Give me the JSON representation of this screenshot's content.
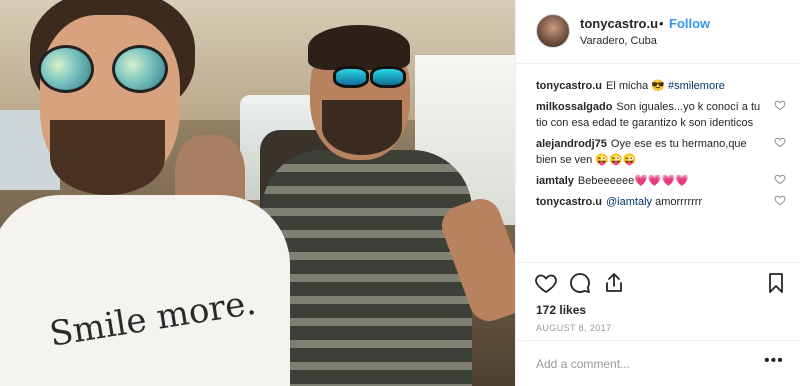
{
  "post": {
    "photo": {
      "alt": "",
      "shirt_text": "Smile more."
    },
    "header": {
      "username": "tonycastro.u",
      "separator": "•",
      "follow_label": "Follow",
      "location": "Varadero, Cuba"
    },
    "comments": [
      {
        "user": "tonycastro.u",
        "text": "El micha 😎",
        "hashtag": "#smilemore",
        "has_like": false
      },
      {
        "user": "milkossalgado",
        "text": "Son iguales...yo k conocí a tu tio con esa edad te garantizo k son identicos",
        "has_like": true
      },
      {
        "user": "alejandrodj75",
        "text": "Oye ese es tu hermano,que bien se ven 😜😜😜",
        "has_like": true
      },
      {
        "user": "iamtaly",
        "text": "Bebeeeeee💗💗💗💗",
        "has_like": true
      },
      {
        "user": "tonycastro.u",
        "mention": "@iamtaly",
        "text": "amorrrrrrr",
        "has_like": true
      }
    ],
    "actions": {
      "icons": [
        "heart-icon",
        "comment-icon",
        "share-icon",
        "bookmark-icon"
      ],
      "likes": "172 likes",
      "date": "AUGUST 8, 2017"
    },
    "add_comment": {
      "placeholder": "Add a comment...",
      "more": "•••"
    }
  }
}
